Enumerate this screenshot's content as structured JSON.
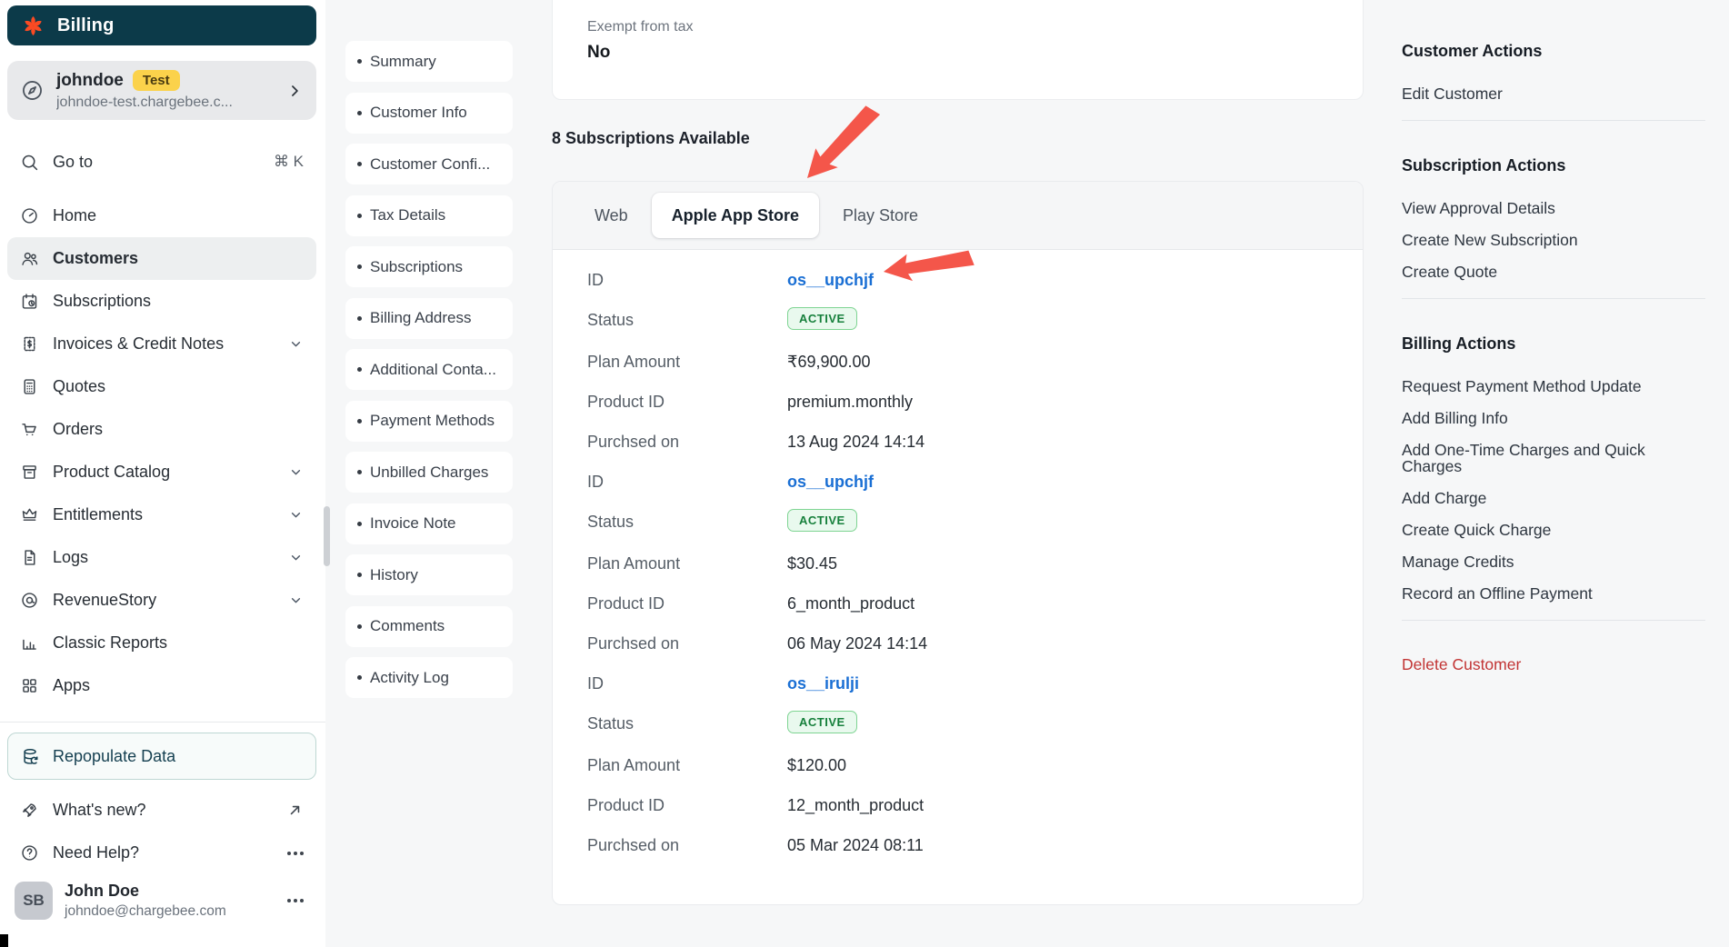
{
  "app": {
    "product_label": "Billing",
    "site": {
      "name": "johndoe",
      "badge": "Test",
      "domain": "johndoe-test.chargebee.c..."
    },
    "search": {
      "label": "Go to",
      "shortcut": "⌘ K"
    }
  },
  "sidebar": {
    "items": [
      {
        "label": "Home",
        "icon": "gauge-icon"
      },
      {
        "label": "Customers",
        "icon": "users-icon",
        "selected": true
      },
      {
        "label": "Subscriptions",
        "icon": "calendar-clock-icon"
      },
      {
        "label": "Invoices & Credit Notes",
        "icon": "invoice-icon",
        "expandable": true
      },
      {
        "label": "Quotes",
        "icon": "calculator-icon"
      },
      {
        "label": "Orders",
        "icon": "cart-icon"
      },
      {
        "label": "Product Catalog",
        "icon": "box-icon",
        "expandable": true
      },
      {
        "label": "Entitlements",
        "icon": "crown-icon",
        "expandable": true
      },
      {
        "label": "Logs",
        "icon": "document-icon",
        "expandable": true
      },
      {
        "label": "RevenueStory",
        "icon": "revenue-icon",
        "expandable": true
      },
      {
        "label": "Classic Reports",
        "icon": "bar-chart-icon"
      },
      {
        "label": "Apps",
        "icon": "grid-icon"
      }
    ],
    "footer": {
      "repopulate_label": "Repopulate Data",
      "whats_new_label": "What's new?",
      "need_help_label": "Need Help?",
      "user": {
        "initials": "SB",
        "name": "John Doe",
        "email": "johndoe@chargebee.com"
      }
    }
  },
  "section_nav": {
    "items": [
      {
        "label": "Summary"
      },
      {
        "label": "Customer Info"
      },
      {
        "label": "Customer Confi..."
      },
      {
        "label": "Tax Details"
      },
      {
        "label": "Subscriptions"
      },
      {
        "label": "Billing Address"
      },
      {
        "label": "Additional Conta..."
      },
      {
        "label": "Payment Methods"
      },
      {
        "label": "Unbilled Charges"
      },
      {
        "label": "Invoice Note"
      },
      {
        "label": "History"
      },
      {
        "label": "Comments"
      },
      {
        "label": "Activity Log"
      }
    ]
  },
  "main": {
    "tax_card": {
      "label": "Exempt from tax",
      "value": "No"
    },
    "subscriptions_heading": "8 Subscriptions Available",
    "tabs": [
      {
        "label": "Web"
      },
      {
        "label": "Apple App Store",
        "active": true
      },
      {
        "label": "Play Store"
      }
    ],
    "field_labels": {
      "id": "ID",
      "status": "Status",
      "plan_amount": "Plan Amount",
      "product_id": "Product ID",
      "purchased_on": "Purchsed on"
    },
    "subscriptions": [
      {
        "id": "os__upchjf",
        "status": "ACTIVE",
        "plan_amount": "₹69,900.00",
        "product_id": "premium.monthly",
        "purchased_on": "13 Aug 2024 14:14"
      },
      {
        "id": "os__upchjf",
        "status": "ACTIVE",
        "plan_amount": "$30.45",
        "product_id": "6_month_product",
        "purchased_on": "06 May 2024 14:14"
      },
      {
        "id": "os__irulji",
        "status": "ACTIVE",
        "plan_amount": "$120.00",
        "product_id": "12_month_product",
        "purchased_on": "05 Mar 2024 08:11"
      }
    ]
  },
  "actions_panel": {
    "groups": [
      {
        "heading": "Customer Actions",
        "items": [
          "Edit Customer"
        ]
      },
      {
        "heading": "Subscription Actions",
        "items": [
          "View Approval Details",
          "Create New Subscription",
          "Create Quote"
        ]
      },
      {
        "heading": "Billing Actions",
        "items": [
          "Request Payment Method Update",
          "Add Billing Info",
          "Add One-Time Charges and Quick Charges",
          "Add Charge",
          "Create Quick Charge",
          "Manage Credits",
          "Record an Offline Payment"
        ]
      }
    ],
    "danger_item": "Delete Customer"
  },
  "colors": {
    "brand_navy": "#0c3a49",
    "brand_red": "#fa4a23",
    "test_badge_yellow": "#fbd24b",
    "link_blue": "#1a6fd4",
    "active_badge_bg": "#e9f9ee",
    "active_badge_border": "#7ed492",
    "active_badge_text": "#17803c",
    "annotation_arrow_red": "#f4564a",
    "danger_red": "#c23434"
  }
}
